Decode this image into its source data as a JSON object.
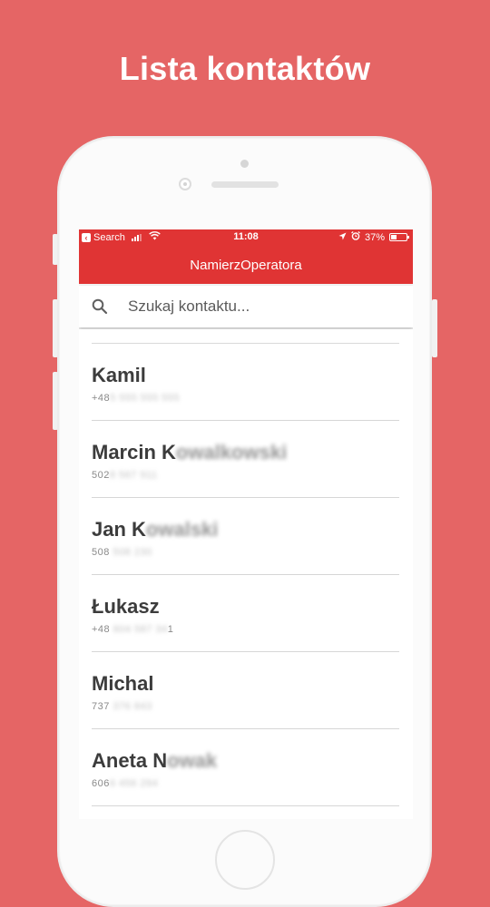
{
  "promo": {
    "headline": "Lista kontaktów"
  },
  "status_bar": {
    "back_label": "Search",
    "time": "11:08",
    "battery": "37%"
  },
  "app": {
    "title": "NamierzOperatora"
  },
  "search": {
    "placeholder": "Szukaj kontaktu..."
  },
  "contacts": [
    {
      "name_visible": "Kamil",
      "name_blurred": "",
      "phone_visible": "+48",
      "phone_blurred": "5 555 555 555"
    },
    {
      "name_visible": "Marcin K",
      "name_blurred": "owalkowski",
      "phone_visible": "502",
      "phone_blurred": "8 567 911"
    },
    {
      "name_visible": "Jan K",
      "name_blurred": "owalski",
      "phone_visible": "508",
      "phone_blurred": "508 230"
    },
    {
      "name_visible": "Łukasz",
      "name_blurred": "",
      "phone_visible": "+48",
      "phone_blurred": "604 587 34",
      "phone_tail": "1"
    },
    {
      "name_visible": "Michal",
      "name_blurred": "",
      "phone_visible": "737",
      "phone_blurred": "376 843"
    },
    {
      "name_visible": "Aneta N",
      "name_blurred": "owak",
      "phone_visible": "606",
      "phone_blurred": "6 456 294"
    }
  ],
  "colors": {
    "background": "#e56565",
    "appbar": "#e03434"
  }
}
